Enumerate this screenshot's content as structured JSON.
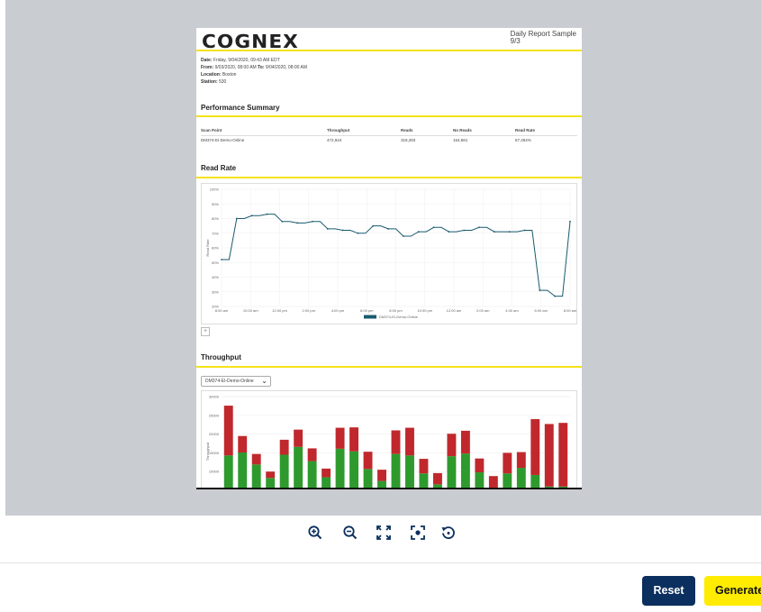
{
  "report": {
    "logo": "COGNEX",
    "title": "Daily Report Sample",
    "subtitle": "9/3",
    "meta": {
      "date_label": "Date:",
      "date": "Friday, 9/04/2020, 09:43 AM EDT",
      "from_label": "From:",
      "from": "9/03/2020, 08:00 AM",
      "to_label": "To:",
      "to": "9/04/2020, 08:00 AM",
      "location_label": "Location:",
      "location": "Boston",
      "station_label": "Station:",
      "station": "530"
    },
    "performance": {
      "heading": "Performance Summary",
      "columns": [
        "Scan Point",
        "Throughput",
        "Reads",
        "No Reads",
        "Read Rate"
      ],
      "row": [
        "DM374-EI-Demo-Online",
        "472,944",
        "318,283",
        "154,661",
        "67.294%"
      ]
    },
    "read_rate_heading": "Read Rate",
    "throughput_heading": "Throughput",
    "plus_label": "+",
    "dropdown_value": "DM374-EI-Demo-Online"
  },
  "chart_data": [
    {
      "type": "line",
      "title": "Read Rate",
      "ylabel": "Read Rate",
      "ylim": [
        20,
        100
      ],
      "y_ticks": [
        "100%",
        "90%",
        "80%",
        "70%",
        "60%",
        "50%",
        "40%",
        "30%",
        "20%"
      ],
      "x_ticks": [
        "8:00 am",
        "10:00 am",
        "12:00 pm",
        "2:00 pm",
        "4:00 pm",
        "6:00 pm",
        "8:00 pm",
        "10:00 pm",
        "12:00 am",
        "2:00 am",
        "4:00 am",
        "6:00 am",
        "8:00 am"
      ],
      "series": [
        {
          "name": "DM374-EI-Demo-Online",
          "color": "#1a5a6e",
          "values": [
            52,
            52,
            80,
            80,
            82,
            82,
            83,
            83,
            78,
            78,
            77,
            77,
            78,
            78,
            73,
            73,
            72,
            72,
            70,
            70,
            75,
            75,
            73,
            73,
            68,
            68,
            71,
            71,
            74,
            74,
            71,
            71,
            72,
            72,
            74,
            74,
            71,
            71,
            71,
            71,
            72,
            72,
            31,
            31,
            27,
            27,
            78
          ]
        }
      ],
      "legend": "bottom",
      "grid": true
    },
    {
      "type": "bar",
      "title": "Throughput",
      "ylabel": "Throughput",
      "stacked": true,
      "y_ticks": [
        "30000",
        "25000",
        "20000",
        "15000",
        "10000"
      ],
      "ylim": [
        5000,
        30500
      ],
      "series": [
        {
          "name": "Reads",
          "color": "#2e9a2e",
          "values": [
            14300,
            15100,
            11900,
            8300,
            14500,
            16600,
            12800,
            8500,
            16100,
            15400,
            10700,
            7500,
            14700,
            14300,
            9500,
            6600,
            14100,
            14800,
            9800,
            5300,
            9500,
            11000,
            9100,
            6000,
            6000
          ]
        },
        {
          "name": "No Reads",
          "color": "#c0282d",
          "values": [
            13300,
            4400,
            2800,
            1700,
            4000,
            4600,
            3400,
            2300,
            5600,
            6400,
            4600,
            3000,
            6300,
            7400,
            3900,
            3000,
            6000,
            6100,
            3700,
            3500,
            5500,
            4200,
            14900,
            16700,
            17000
          ]
        }
      ]
    }
  ],
  "toolbar": {
    "zoom_in": "zoom-in-icon",
    "zoom_out": "zoom-out-icon",
    "fit": "fit-screen-icon",
    "center": "center-focus-icon",
    "reset_view": "reset-view-icon"
  },
  "actions": {
    "reset_label": "Reset",
    "generate_label": "Generate"
  },
  "colors": {
    "accent_yellow": "#ffec00",
    "navy": "#0b2f5e",
    "report_rule": "#f5e316"
  }
}
